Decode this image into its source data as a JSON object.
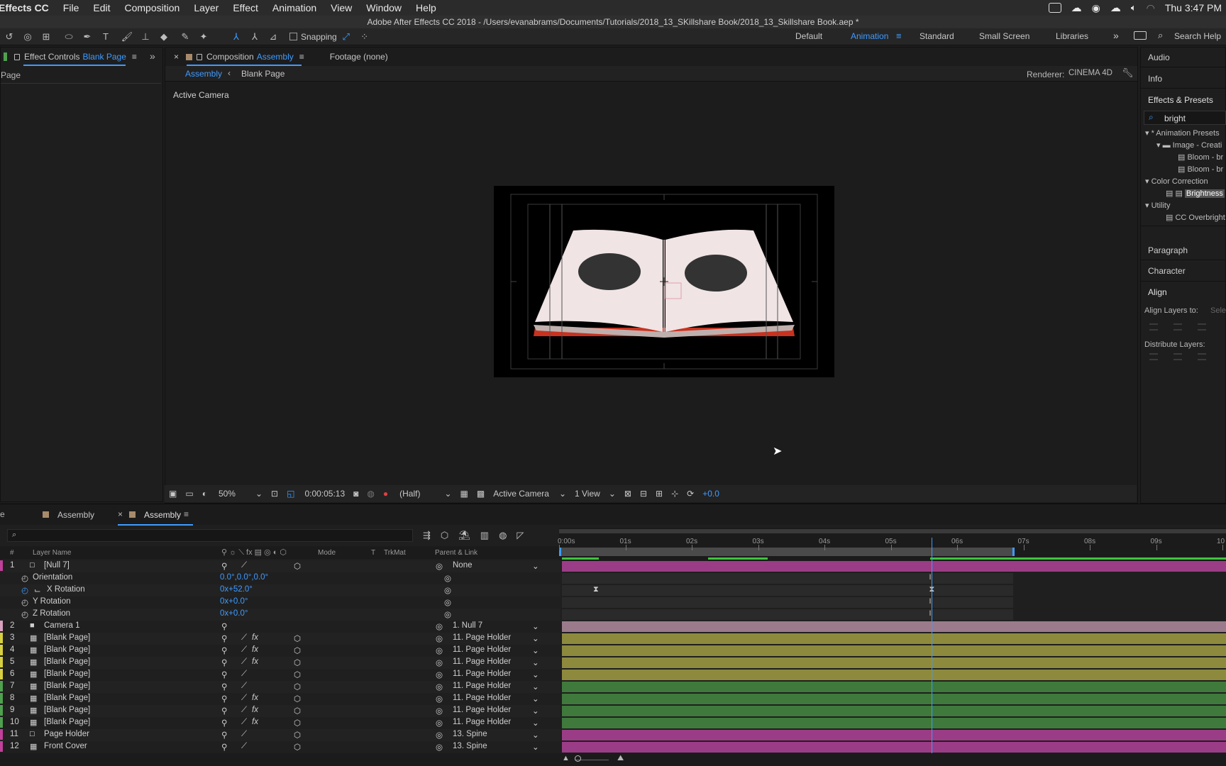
{
  "menubar": {
    "app": "Effects CC",
    "items": [
      "File",
      "Edit",
      "Composition",
      "Layer",
      "Effect",
      "Animation",
      "View",
      "Window",
      "Help"
    ],
    "clock": "Thu 3:47 PM"
  },
  "titlebar": {
    "text": "Adobe After Effects CC 2018 - /Users/evanabrams/Documents/Tutorials/2018_13_SKillshare Book/2018_13_Skillshare Book.aep *"
  },
  "toolbar": {
    "snapping_label": "Snapping",
    "workspaces": [
      "Default",
      "Animation",
      "Standard",
      "Small Screen",
      "Libraries"
    ],
    "active_workspace": "Animation",
    "search_help": "Search Help"
  },
  "effect_controls": {
    "tab_prefix": "Effect Controls",
    "tab_target": "Blank Page",
    "sub_label": "Page"
  },
  "composition": {
    "tab_prefix": "Composition",
    "tab_target": "Assembly",
    "footage_tab": "Footage (none)",
    "breadcrumb_active": "Assembly",
    "breadcrumb_child": "Blank Page",
    "renderer_label": "Renderer:",
    "renderer_value": "CINEMA 4D",
    "view_label": "Active Camera"
  },
  "viewer_bar": {
    "zoom": "50%",
    "timecode": "0:00:05:13",
    "resolution": "(Half)",
    "camera": "Active Camera",
    "views": "1 View",
    "exposure": "+0.0"
  },
  "right_panel": {
    "tabs": [
      "Audio",
      "Info",
      "Effects & Presets"
    ],
    "search_value": "bright",
    "tree": [
      "* Animation Presets",
      "Image - Creati",
      "Bloom - br",
      "Bloom - br",
      "Color Correction",
      "Brightness",
      "Utility",
      "CC Overbright"
    ],
    "panels": [
      "Paragraph",
      "Character",
      "Align"
    ],
    "align_label": "Align Layers to:",
    "align_value": "Sele",
    "distribute_label": "Distribute Layers:"
  },
  "timeline": {
    "tabs": [
      "Assembly",
      "Assembly"
    ],
    "columns": {
      "num": "#",
      "layer_name": "Layer Name",
      "mode": "Mode",
      "t": "T",
      "trkmat": "TrkMat",
      "parent": "Parent & Link"
    },
    "ruler": [
      "0:00s",
      "01s",
      "02s",
      "03s",
      "04s",
      "05s",
      "06s",
      "07s",
      "08s",
      "09s",
      "10"
    ],
    "current_time_fraction": 0.558,
    "layers": [
      {
        "num": "1",
        "name": "[Null 7]",
        "parent": "None",
        "color": "#c0409a",
        "bar": "#9b3d86",
        "type": "null"
      },
      {
        "num": "",
        "name": "Orientation",
        "value": "0.0°,0.0°,0.0°",
        "prop": true
      },
      {
        "num": "",
        "name": "X Rotation",
        "value": "0x+52.0°",
        "prop": true
      },
      {
        "num": "",
        "name": "Y Rotation",
        "value": "0x+0.0°",
        "prop": true
      },
      {
        "num": "",
        "name": "Z Rotation",
        "value": "0x+0.0°",
        "prop": true
      },
      {
        "num": "2",
        "name": "Camera 1",
        "parent": "1. Null 7",
        "color": "#d9a0c0",
        "bar": "#9b7b8b",
        "type": "camera"
      },
      {
        "num": "3",
        "name": "[Blank Page]",
        "parent": "11. Page Holder",
        "color": "#d8d040",
        "bar": "#8d8a3d",
        "type": "comp",
        "fx": true
      },
      {
        "num": "4",
        "name": "[Blank Page]",
        "parent": "11. Page Holder",
        "color": "#d8d040",
        "bar": "#8d8a3d",
        "type": "comp",
        "fx": true
      },
      {
        "num": "5",
        "name": "[Blank Page]",
        "parent": "11. Page Holder",
        "color": "#d8d040",
        "bar": "#8d8a3d",
        "type": "comp",
        "fx": true
      },
      {
        "num": "6",
        "name": "[Blank Page]",
        "parent": "11. Page Holder",
        "color": "#d8d040",
        "bar": "#8d8a3d",
        "type": "comp",
        "fx": false
      },
      {
        "num": "7",
        "name": "[Blank Page]",
        "parent": "11. Page Holder",
        "color": "#4fa04f",
        "bar": "#3f7a3c",
        "type": "comp",
        "fx": false
      },
      {
        "num": "8",
        "name": "[Blank Page]",
        "parent": "11. Page Holder",
        "color": "#4fa04f",
        "bar": "#3f7a3c",
        "type": "comp",
        "fx": true
      },
      {
        "num": "9",
        "name": "[Blank Page]",
        "parent": "11. Page Holder",
        "color": "#4fa04f",
        "bar": "#3f7a3c",
        "type": "comp",
        "fx": true
      },
      {
        "num": "10",
        "name": "[Blank Page]",
        "parent": "11. Page Holder",
        "color": "#4fa04f",
        "bar": "#3f7a3c",
        "type": "comp",
        "fx": true
      },
      {
        "num": "11",
        "name": "Page Holder",
        "parent": "13. Spine",
        "color": "#c0409a",
        "bar": "#9b3d86",
        "type": "solid"
      },
      {
        "num": "12",
        "name": "Front Cover",
        "parent": "13. Spine",
        "color": "#c0409a",
        "bar": "#9b3d86",
        "type": "comp"
      }
    ]
  }
}
